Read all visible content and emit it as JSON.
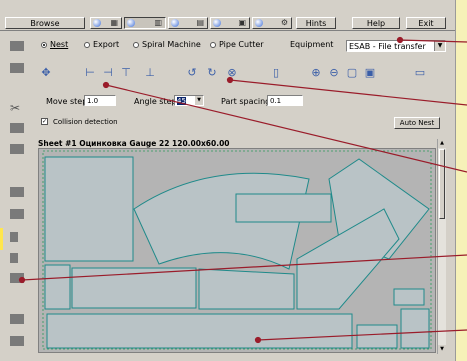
{
  "toolbar": {
    "browse_label": "Browse",
    "hints_label": "Hints",
    "help_label": "Help",
    "exit_label": "Exit",
    "icon_buttons": [
      "page-icon",
      "grid-icon",
      "stack-icon",
      "folder-icon",
      "print-icon",
      "scissors-icon",
      "export-icon"
    ]
  },
  "mode": {
    "nest_label": "Nest",
    "export_label": "Export",
    "spiral_label": "Spiral Machine",
    "pipe_label": "Pipe Cutter",
    "selected": "Nest",
    "equipment_label": "Equipment",
    "equipment_value": "ESAB - File transfer"
  },
  "fields": {
    "move_step_label": "Move step:",
    "move_step_value": "1.0",
    "angle_step_label": "Angle step:",
    "angle_step_value": "45",
    "part_spacing_label": "Part spacing:",
    "part_spacing_value": "0.1"
  },
  "collision": {
    "label": "Collision detection",
    "checked": true
  },
  "auto_nest_label": "Auto Nest",
  "sheet": {
    "title": "Sheet #1 Оцинковка Gauge 22 120.00x60.00"
  },
  "colors": {
    "part_outline": "#1f8a8a",
    "callout_line": "#9a1c2a",
    "sheet_bg": "#b4b4b4",
    "margin_bg": "#f6f1b8"
  }
}
